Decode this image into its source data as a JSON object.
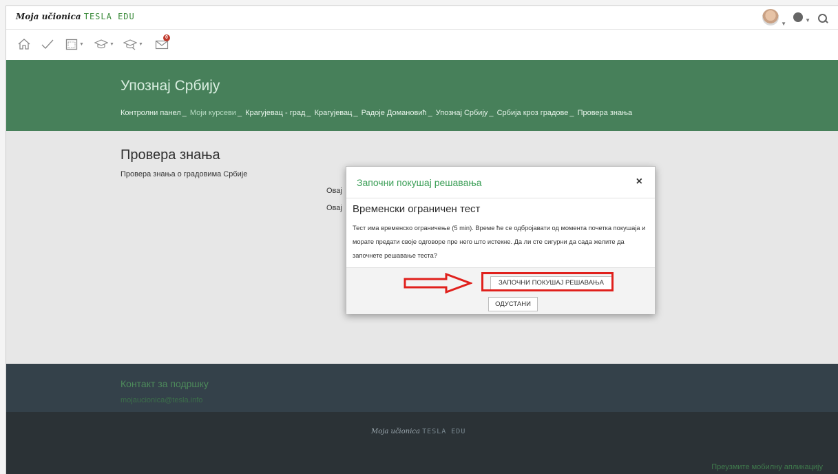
{
  "app": {
    "logo_script": "Moja učionica",
    "logo_brand": "TESLA EDU"
  },
  "header": {
    "title": "Упознај Србију",
    "breadcrumbs": [
      "Контролни панел",
      "Моји курсеви",
      "Крагујевац - град",
      "Крагујевац",
      "Радоје Домановић",
      "Упознај Србију",
      "Србија кроз градове",
      "Провера знања"
    ]
  },
  "notifications": {
    "count": "0"
  },
  "main": {
    "title": "Провера знања",
    "subtitle": "Провера знања о градовима Србије",
    "partial_line_1": "Овај",
    "partial_line_2": "Овај"
  },
  "modal": {
    "title": "Започни покушај решавања",
    "close": "×",
    "heading": "Временски ограничен тест",
    "body": "Тест има временско ограничење (5 min). Време ће се одбројавати од момента почетка покушаја и морате предати своје одговоре пре него што истекне. Да ли сте сигурни да сада желите да започнете решавање теста?",
    "start_button": "ЗАПОЧНИ ПОКУШАЈ РЕШАВАЊА",
    "cancel_button": "ОДУСТАНИ"
  },
  "footer": {
    "support_title": "Контакт за подршку",
    "support_email": "mojaucionica@tesla.info",
    "logo_script": "Moja učionica",
    "logo_brand": "TESLA EDU",
    "mobile_link": "Преузмите мобилну апликацију"
  },
  "colors": {
    "hero": "#47805a",
    "accent": "#3d9f58",
    "footer": "#34414a",
    "highlight": "#e0201c"
  }
}
